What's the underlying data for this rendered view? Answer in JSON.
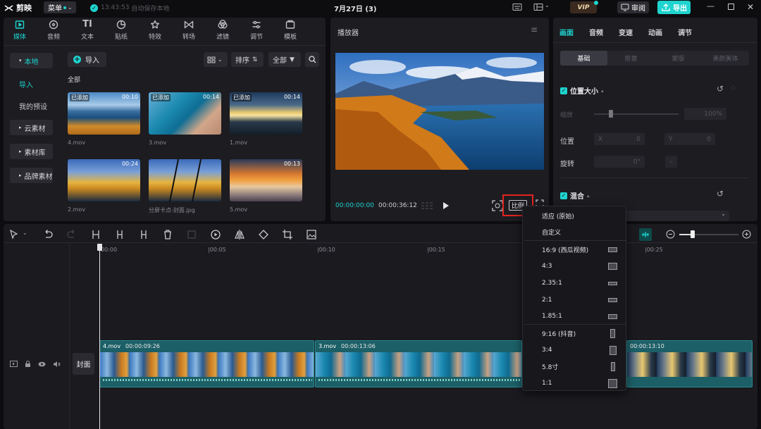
{
  "app": {
    "name": "剪映",
    "menu": "菜单",
    "status_time": "13:43:53",
    "status_text": "自动保存本地",
    "title": "7月27日 (3)",
    "vip": "VIP",
    "review": "审阅",
    "export": "导出"
  },
  "media_tabs": [
    {
      "label": "媒体"
    },
    {
      "label": "音频"
    },
    {
      "label": "文本"
    },
    {
      "label": "贴纸"
    },
    {
      "label": "特效"
    },
    {
      "label": "转场"
    },
    {
      "label": "滤镜"
    },
    {
      "label": "调节"
    },
    {
      "label": "模板"
    }
  ],
  "left_nav": {
    "local": "本地",
    "import": "导入",
    "presets": "我的预设",
    "cloud": "云素材",
    "library": "素材库",
    "brand": "品牌素材"
  },
  "media_toolbar": {
    "import_btn": "导入",
    "sort": "排序",
    "all": "全部",
    "section": "全部"
  },
  "media_items": [
    {
      "name": "4.mov",
      "added": "已添加",
      "duration": "00:10"
    },
    {
      "name": "3.mov",
      "added": "已添加",
      "duration": "00:14"
    },
    {
      "name": "1.mov",
      "added": "已添加",
      "duration": "00:14"
    },
    {
      "name": "2.mov",
      "added": "",
      "duration": "00:24"
    },
    {
      "name": "分屏卡点-封面.jpg",
      "added": "",
      "duration": ""
    },
    {
      "name": "5.mov",
      "added": "",
      "duration": "00:13"
    }
  ],
  "player": {
    "title": "播放器",
    "current": "00:00:00:00",
    "total": "00:00:36:12",
    "ratio_btn": "比例"
  },
  "ratio_menu": [
    {
      "label": "适应 (原始)",
      "shape": "none"
    },
    {
      "label": "自定义",
      "shape": "none"
    },
    {
      "label": "16:9 (西瓜视频)",
      "shape": "wide"
    },
    {
      "label": "4:3",
      "shape": "43"
    },
    {
      "label": "2.35:1",
      "shape": "cine"
    },
    {
      "label": "2:1",
      "shape": "two"
    },
    {
      "label": "1.85:1",
      "shape": "185"
    },
    {
      "label": "9:16 (抖音)",
      "shape": "tall"
    },
    {
      "label": "3:4",
      "shape": "34"
    },
    {
      "label": "5.8寸",
      "shape": "58"
    },
    {
      "label": "1:1",
      "shape": "sq"
    }
  ],
  "inspector": {
    "tabs": [
      "画面",
      "音频",
      "变速",
      "动画",
      "调节"
    ],
    "subtabs": [
      "基础",
      "抠像",
      "蒙版",
      "美颜美体"
    ],
    "position_size": "位置大小",
    "scale": "缩放",
    "scale_val": "100%",
    "position": "位置",
    "x_label": "X",
    "x_val": "0",
    "y_label": "Y",
    "y_val": "0",
    "rotate": "旋转",
    "rotate_val": "0°",
    "blend": "混合"
  },
  "timeline": {
    "ticks": [
      "00:00",
      "|00:05",
      "|00:10",
      "|00:15",
      "|00:25"
    ],
    "cover": "封面",
    "clips": [
      {
        "name": "4.mov",
        "duration": "00:00:09:26"
      },
      {
        "name": "3.mov",
        "duration": "00:00:13:06"
      },
      {
        "name": "",
        "duration": "00:00:13:10"
      }
    ]
  }
}
